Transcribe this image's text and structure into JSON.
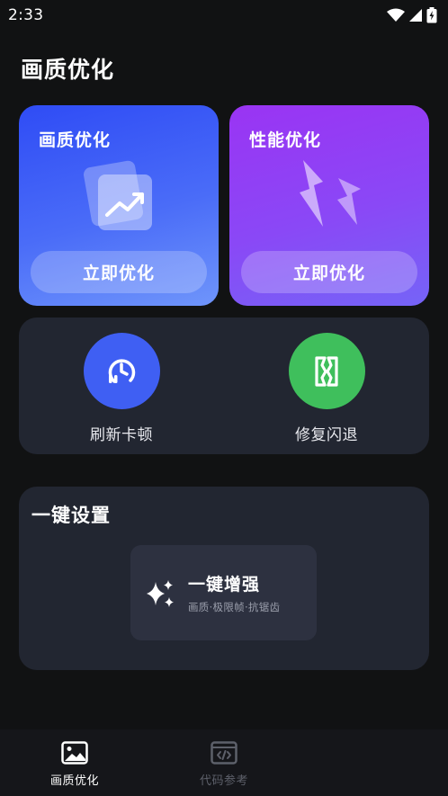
{
  "status_bar": {
    "time": "2:33",
    "icons": [
      "wifi-icon",
      "signal-icon",
      "battery-icon"
    ]
  },
  "header": {
    "title": "画质优化"
  },
  "cards": [
    {
      "title": "画质优化",
      "button_label": "立即优化",
      "icon": "trend-chart-icon",
      "color": "#3a57f6"
    },
    {
      "title": "性能优化",
      "button_label": "立即优化",
      "icon": "lightning-icon",
      "color": "#8b44f5"
    }
  ],
  "tools": [
    {
      "label": "刷新卡顿",
      "icon": "refresh-clock-icon",
      "color": "#3f5ff3"
    },
    {
      "label": "修复闪退",
      "icon": "repair-icon",
      "color": "#3fbf5c"
    }
  ],
  "setup": {
    "title": "一键设置",
    "boost": {
      "title": "一键增强",
      "subtitle": "画质·极限帧·抗锯齿",
      "icon": "sparkle-icon"
    }
  },
  "bottom_nav": {
    "items": [
      {
        "label": "画质优化",
        "icon": "image-icon",
        "active": true
      },
      {
        "label": "代码参考",
        "icon": "code-icon",
        "active": false
      }
    ]
  }
}
